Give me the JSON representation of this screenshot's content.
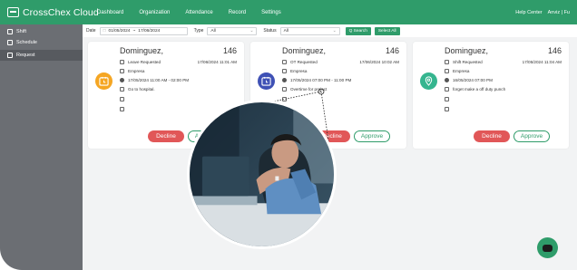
{
  "brand": {
    "name": "CrossChex Cloud",
    "icon": "monitor-icon"
  },
  "nav": [
    "Dashboard",
    "Organization",
    "Attendance",
    "Record",
    "Settings"
  ],
  "top_right": {
    "help": "Help Center",
    "user": "Anviz | Fu"
  },
  "sidebar": [
    {
      "label": "Shift",
      "icon": "shift-icon",
      "active": false
    },
    {
      "label": "Schedule",
      "icon": "schedule-icon",
      "active": false
    },
    {
      "label": "Request",
      "icon": "request-icon",
      "active": true
    }
  ],
  "filters": {
    "date_label": "Date",
    "date_from": "01/05/2024",
    "date_sep": "~",
    "date_to": "17/06/2024",
    "type_label": "Type",
    "type_value": "All",
    "status_label": "Status",
    "status_value": "All",
    "search_label": "Q Search",
    "select_all_label": "Select All"
  },
  "cards": [
    {
      "name": "Dominguez,",
      "number": "146",
      "request_type": "Leave Requested",
      "requested_at": "17/06/2024 11:01 AM",
      "org": "Empresa",
      "period": "17/05/2024 11:00 AM - 02:00 PM",
      "note": "Go to hospital.",
      "icon": "clock-icon",
      "icon_color": "#f5a623",
      "decline": "Decline",
      "approve": "Approve"
    },
    {
      "name": "Dominguez,",
      "number": "146",
      "request_type": "OT Requested",
      "requested_at": "17/06/2024 10:02 AM",
      "org": "Empresa",
      "period": "17/05/2024 07:00 PM - 11:00 PM",
      "note": "Overtime for project",
      "icon": "alarm-clock-icon",
      "icon_color": "#3f51b5",
      "decline": "Decline",
      "approve": "Approve"
    },
    {
      "name": "Dominguez,",
      "number": "146",
      "request_type": "Shift Requested",
      "requested_at": "17/05/2024 11:04 AM",
      "org": "Empresa",
      "period": "16/05/2024 07:00 PM",
      "note": "forget make a off duty punch",
      "icon": "location-pin-icon",
      "icon_color": "#35b58f",
      "decline": "Decline",
      "approve": "Approve"
    }
  ],
  "chat_icon": "chat-icon"
}
